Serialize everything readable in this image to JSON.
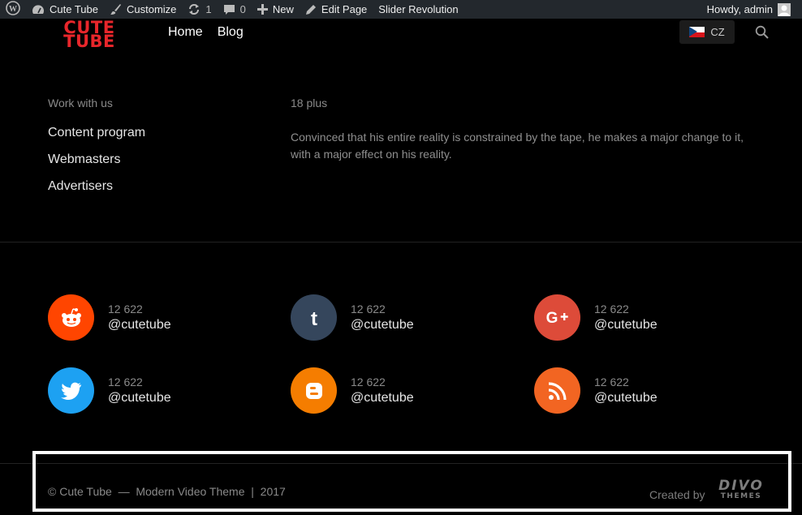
{
  "adminbar": {
    "site_name": "Cute Tube",
    "customize": "Customize",
    "updates_count": "1",
    "comments_count": "0",
    "new_label": "New",
    "edit_page": "Edit Page",
    "slider": "Slider Revolution",
    "greeting": "Howdy, admin"
  },
  "header": {
    "logo_line1": "CUTE",
    "logo_line2": "TUBE",
    "nav": [
      "Home",
      "Blog"
    ],
    "lang_code": "CZ"
  },
  "footer": {
    "work_title": "Work with us",
    "work_links": [
      "Content program",
      "Webmasters",
      "Advertisers"
    ],
    "about_title": "18 plus",
    "about_text": "Convinced that his entire reality is constrained by the tape, he makes a major change to it, with a major effect on his reality."
  },
  "social": [
    {
      "network": "reddit",
      "icon": "reddit-icon",
      "color": "#ff4500",
      "count": "12 622",
      "handle": "@cutetube"
    },
    {
      "network": "tumblr",
      "icon": "tumblr-icon",
      "color": "#35465c",
      "count": "12 622",
      "handle": "@cutetube"
    },
    {
      "network": "google-plus",
      "icon": "google-plus-icon",
      "color": "#dd4b39",
      "count": "12 622",
      "handle": "@cutetube"
    },
    {
      "network": "twitter",
      "icon": "twitter-icon",
      "color": "#1da1f2",
      "count": "12 622",
      "handle": "@cutetube"
    },
    {
      "network": "blogger",
      "icon": "blogger-icon",
      "color": "#f57d00",
      "count": "12 622",
      "handle": "@cutetube"
    },
    {
      "network": "rss",
      "icon": "rss-icon",
      "color": "#f26522",
      "count": "12 622",
      "handle": "@cutetube"
    }
  ],
  "bottom": {
    "copyright": "© Cute Tube  —  Modern Video Theme  |  2017",
    "created_by": "Created by",
    "brand_line1": "DIVO",
    "brand_line2": "THEMES"
  }
}
